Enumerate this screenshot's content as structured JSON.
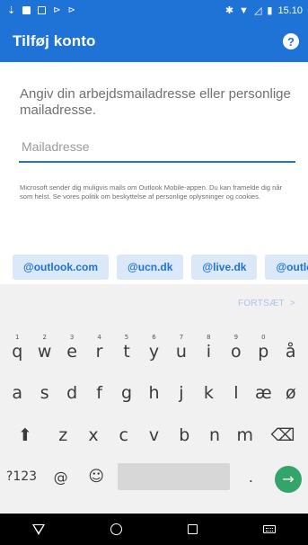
{
  "status_bar": {
    "time": "15.10",
    "icons": [
      "download-icon",
      "image-icon",
      "sim-icon",
      "cast-icon",
      "cast-icon",
      "bluetooth-icon",
      "wifi-icon",
      "signal-icon",
      "battery-icon"
    ]
  },
  "app_bar": {
    "title": "Tilføj konto",
    "help_label": "?"
  },
  "form": {
    "prompt": "Angiv din arbejdsmailadresse eller personlige mailadresse.",
    "email_placeholder": "Mailadresse",
    "email_value": "",
    "disclaimer": "Microsoft sender dig muligvis mails om Outlook Mobile-appen. Du kan framelde dig når som helst. Se vores politik om beskyttelse af personlige oplysninger og cookies."
  },
  "suggestions": [
    "@outlook.com",
    "@ucn.dk",
    "@live.dk",
    "@outloo"
  ],
  "continue": {
    "label": "FORTSÆT",
    "arrow": ">"
  },
  "keyboard": {
    "row1": [
      {
        "key": "q",
        "hint": "1"
      },
      {
        "key": "w",
        "hint": "2"
      },
      {
        "key": "e",
        "hint": "3"
      },
      {
        "key": "r",
        "hint": "4"
      },
      {
        "key": "t",
        "hint": "5"
      },
      {
        "key": "y",
        "hint": "6"
      },
      {
        "key": "u",
        "hint": "7"
      },
      {
        "key": "i",
        "hint": "8"
      },
      {
        "key": "o",
        "hint": "9"
      },
      {
        "key": "p",
        "hint": "0"
      },
      {
        "key": "å",
        "hint": ""
      }
    ],
    "row2": [
      "a",
      "s",
      "d",
      "f",
      "g",
      "h",
      "j",
      "k",
      "l",
      "æ",
      "ø"
    ],
    "row3": [
      "z",
      "x",
      "c",
      "v",
      "b",
      "n",
      "m"
    ],
    "row4": {
      "symbols": "?123",
      "at": "@",
      "emoji": "☺",
      "period": ".",
      "enter": "→"
    },
    "shift": "⬆",
    "backspace": "⌫"
  },
  "colors": {
    "brand": "#1f73d6",
    "chip_bg": "#dbe8f7",
    "enter": "#34a56a",
    "continue_disabled": "#a9c6ea"
  }
}
